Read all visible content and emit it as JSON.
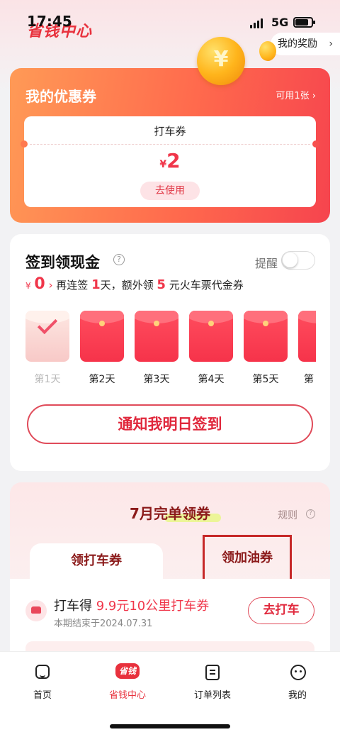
{
  "status_bar": {
    "time": "17:45",
    "network": "5G"
  },
  "header": {
    "brand": "省钱中心",
    "rewards_label": "我的奖励"
  },
  "coupons": {
    "title": "我的优惠券",
    "available": "可用1张 ›",
    "ticket": {
      "name": "打车券",
      "currency": "¥",
      "amount": "2",
      "use_label": "去使用"
    }
  },
  "checkin": {
    "title": "签到领现金",
    "remind_label": "提醒",
    "remind_on": false,
    "cash_symbol": "¥",
    "cash_amount": "0",
    "cash_arrow": "›",
    "text_1": "再连签",
    "days_more": "1",
    "text_2": "天，额外领",
    "bonus_amount": "5",
    "text_3": "元火车票代金券",
    "days": [
      {
        "label": "第1天",
        "done": true
      },
      {
        "label": "第2天",
        "done": false
      },
      {
        "label": "第3天",
        "done": false
      },
      {
        "label": "第4天",
        "done": false
      },
      {
        "label": "第5天",
        "done": false
      },
      {
        "label": "第",
        "done": false
      }
    ],
    "notify_label": "通知我明日签到"
  },
  "monthly": {
    "title": "7月完单领券",
    "rules": "规则",
    "tabs": [
      {
        "label": "领打车券"
      },
      {
        "label": "领加油券"
      }
    ],
    "task": {
      "title_prefix": "打车得",
      "title_highlight": "9.9元10公里打车券",
      "subtitle": "本期结束于2024.07.31",
      "button": "去打车"
    }
  },
  "bottom_nav": {
    "items": [
      {
        "label": "首页",
        "icon": "home-icon"
      },
      {
        "label": "省钱中心",
        "icon": "save-money-icon",
        "badge": "省钱"
      },
      {
        "label": "订单列表",
        "icon": "order-list-icon"
      },
      {
        "label": "我的",
        "icon": "profile-icon"
      }
    ]
  },
  "colors": {
    "accent": "#e8313d",
    "dark_red": "#8b1a1a"
  }
}
